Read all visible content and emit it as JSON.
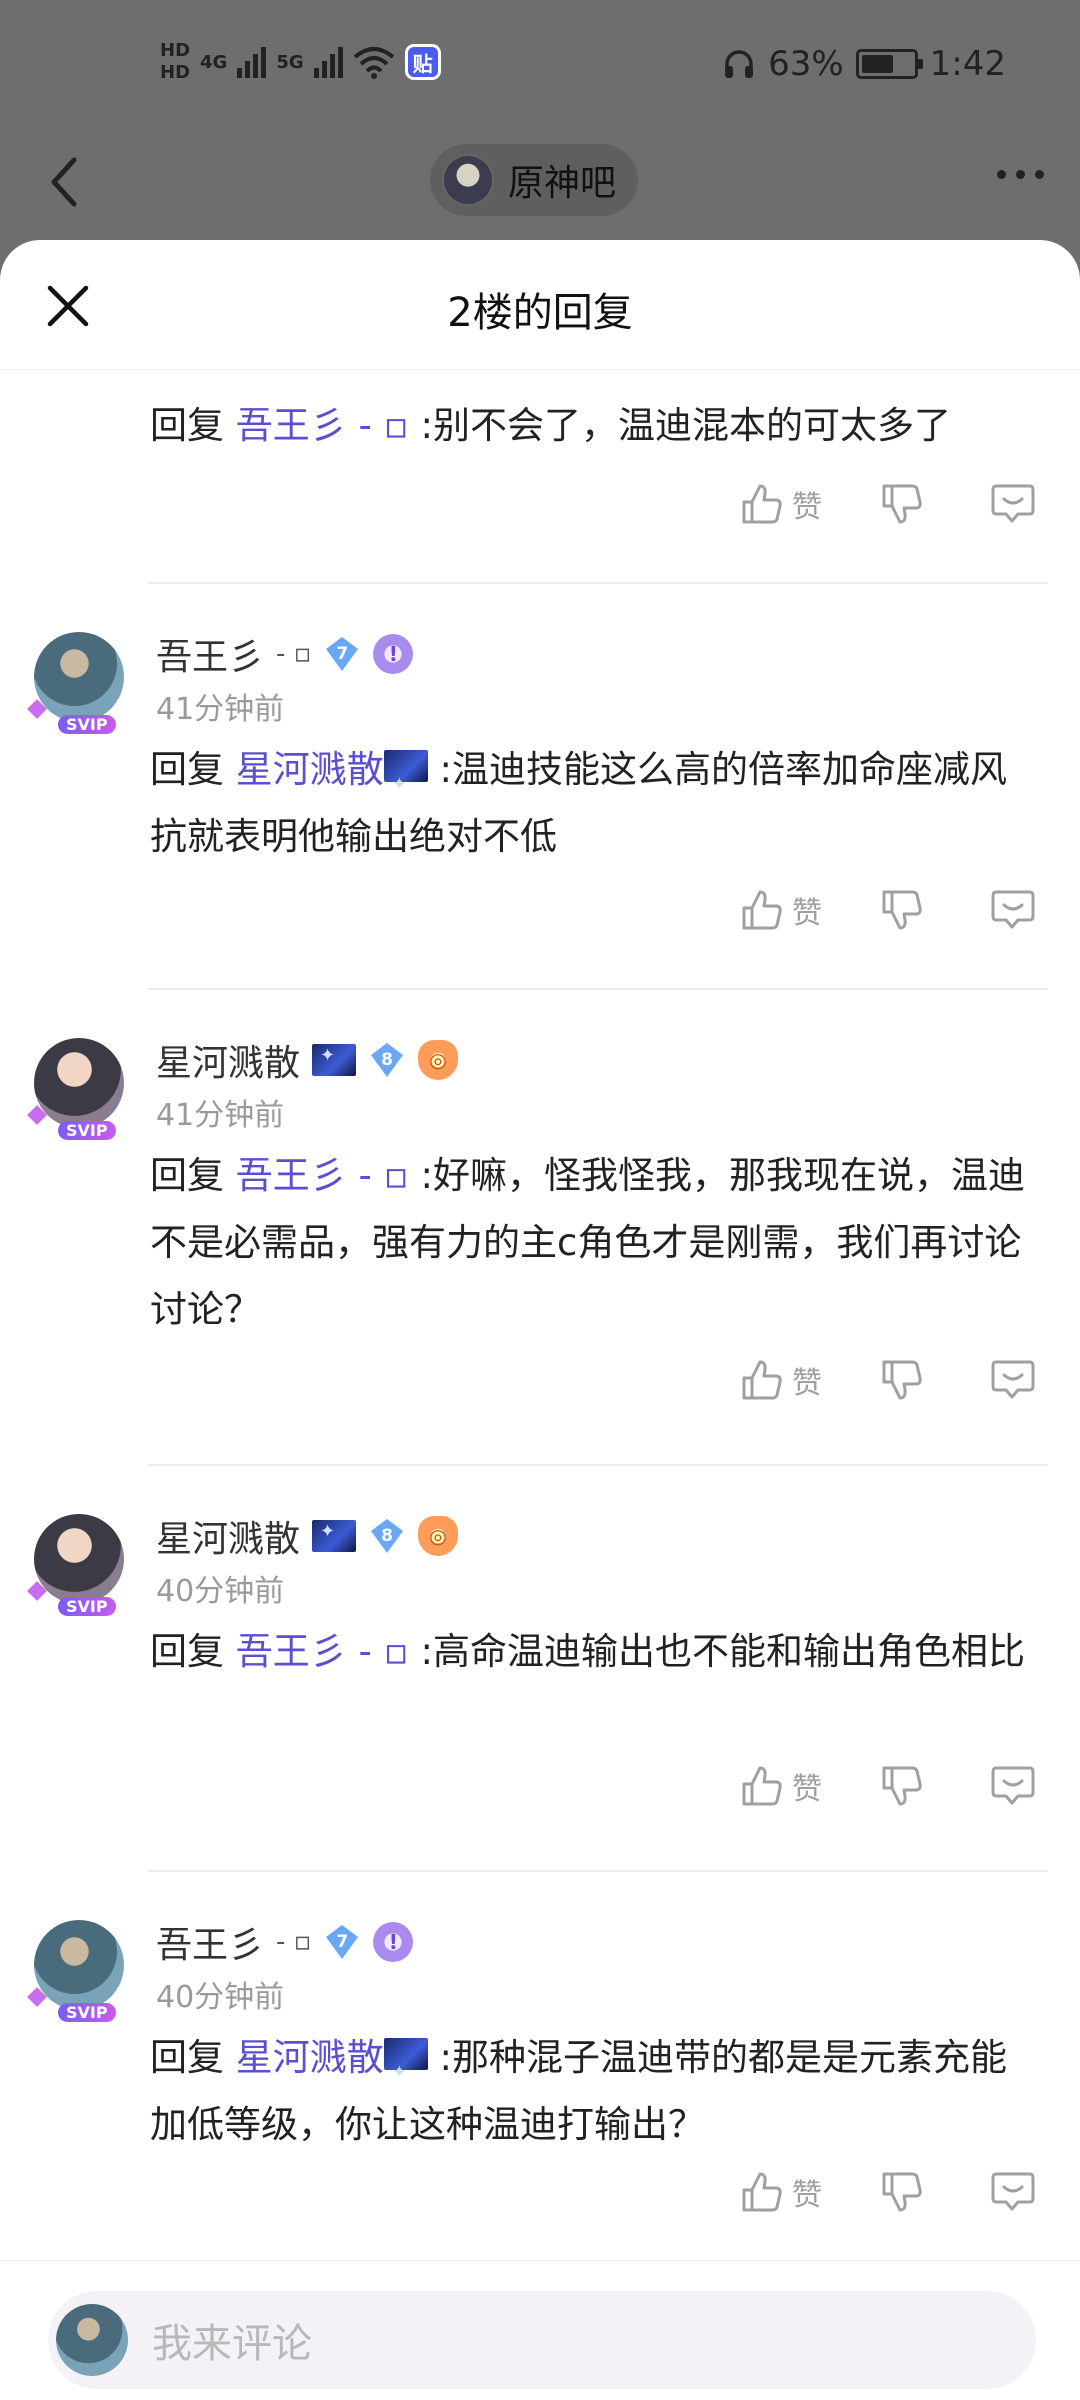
{
  "status_bar": {
    "hd1": "HD",
    "hd2": "HD",
    "net1": "4G",
    "net2": "5G",
    "app_badge": "贴",
    "battery_text": "63%",
    "battery_level": 0.63,
    "time": "1:42"
  },
  "top_nav": {
    "forum_name": "原神吧"
  },
  "sheet": {
    "title": "2楼的回复"
  },
  "replies": [
    {
      "partial": true,
      "reply_prefix": "回复",
      "mention": "吾王彡",
      "mention_suffix": "- ▫",
      "body": ":别不会了，温迪混本的可太多了",
      "like_label": "赞"
    },
    {
      "username": "吾王彡",
      "name_suffix": "- ▫",
      "level": "7",
      "medal": "!",
      "time": "41分钟前",
      "reply_prefix": "回复",
      "mention": "星河溅散",
      "body": ":温迪技能这么高的倍率加命座减风抗就表明他输出绝对不低",
      "like_label": "赞"
    },
    {
      "username": "星河溅散",
      "level": "8",
      "medal": "◎",
      "time": "41分钟前",
      "reply_prefix": "回复",
      "mention": "吾王彡",
      "mention_suffix": "- ▫",
      "body": ":好嘛，怪我怪我，那我现在说，温迪不是必需品，强有力的主c角色才是刚需，我们再讨论讨论？",
      "like_label": "赞"
    },
    {
      "username": "星河溅散",
      "level": "8",
      "medal": "◎",
      "time": "40分钟前",
      "reply_prefix": "回复",
      "mention": "吾王彡",
      "mention_suffix": "- ▫",
      "body": ":高命温迪输出也不能和输出角色相比",
      "like_label": "赞"
    },
    {
      "username": "吾王彡",
      "name_suffix": "- ▫",
      "level": "7",
      "medal": "!",
      "time": "40分钟前",
      "reply_prefix": "回复",
      "mention": "星河溅散",
      "body": ":那种混子温迪带的都是是元素充能加低等级，你让这种温迪打输出？",
      "like_label": "赞"
    }
  ],
  "composer": {
    "placeholder": "我来评论"
  },
  "colors": {
    "mention": "#5a4fd0",
    "level_badge": "#6aa8f5",
    "time_gray": "#9a9a9a"
  }
}
